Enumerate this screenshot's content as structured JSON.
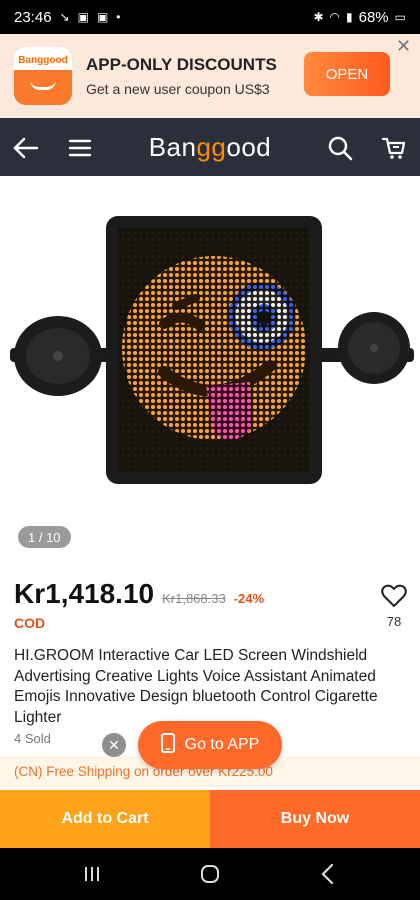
{
  "status_bar": {
    "time": "23:46",
    "icons_left": [
      "call-icon",
      "mail-icon",
      "mail-icon",
      "dot-icon"
    ],
    "battery": "68%"
  },
  "app_banner": {
    "logo_text": "Banggood",
    "title": "APP-ONLY DISCOUNTS",
    "subtitle": "Get a new user coupon US$3",
    "open_label": "OPEN"
  },
  "nav": {
    "logo_prefix": "Ban",
    "logo_highlight": "gg",
    "logo_suffix": "ood"
  },
  "gallery": {
    "counter": "1 / 10"
  },
  "product": {
    "price": "Kr1,418.10",
    "old_price": "Kr1,868.33",
    "discount": "-24%",
    "cod": "COD",
    "wishlist_count": "78",
    "title": "HI.GROOM Interactive Car LED Screen Windshield Advertising Creative Lights Voice Assistant Animated Emojis Innovative Design bluetooth Control  Cigarette Lighter",
    "sold": "4 Sold"
  },
  "shipping": {
    "text": "(CN) Free Shipping on order over Kr225.00"
  },
  "float": {
    "go_app_label": "Go to APP"
  },
  "actions": {
    "add_to_cart": "Add to Cart",
    "buy_now": "Buy Now"
  },
  "colors": {
    "accent": "#ff6a2a",
    "cart": "#ffa31a",
    "nav_bg": "#2b2f3c",
    "discount": "#e8531d"
  }
}
